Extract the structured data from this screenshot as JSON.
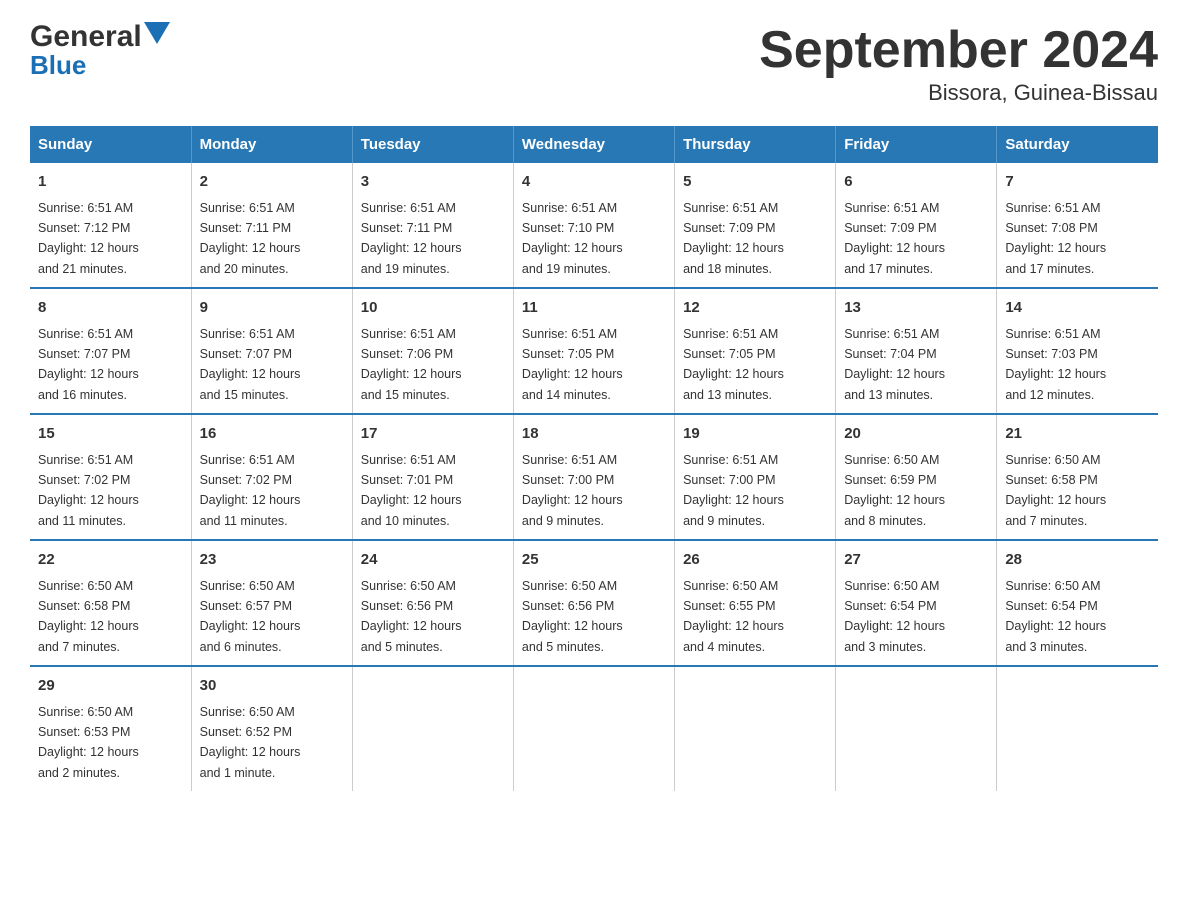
{
  "header": {
    "logo_general": "General",
    "logo_blue": "Blue",
    "title": "September 2024",
    "subtitle": "Bissora, Guinea-Bissau"
  },
  "days_of_week": [
    "Sunday",
    "Monday",
    "Tuesday",
    "Wednesday",
    "Thursday",
    "Friday",
    "Saturday"
  ],
  "weeks": [
    [
      {
        "day": "1",
        "sunrise": "6:51 AM",
        "sunset": "7:12 PM",
        "daylight": "12 hours and 21 minutes."
      },
      {
        "day": "2",
        "sunrise": "6:51 AM",
        "sunset": "7:11 PM",
        "daylight": "12 hours and 20 minutes."
      },
      {
        "day": "3",
        "sunrise": "6:51 AM",
        "sunset": "7:11 PM",
        "daylight": "12 hours and 19 minutes."
      },
      {
        "day": "4",
        "sunrise": "6:51 AM",
        "sunset": "7:10 PM",
        "daylight": "12 hours and 19 minutes."
      },
      {
        "day": "5",
        "sunrise": "6:51 AM",
        "sunset": "7:09 PM",
        "daylight": "12 hours and 18 minutes."
      },
      {
        "day": "6",
        "sunrise": "6:51 AM",
        "sunset": "7:09 PM",
        "daylight": "12 hours and 17 minutes."
      },
      {
        "day": "7",
        "sunrise": "6:51 AM",
        "sunset": "7:08 PM",
        "daylight": "12 hours and 17 minutes."
      }
    ],
    [
      {
        "day": "8",
        "sunrise": "6:51 AM",
        "sunset": "7:07 PM",
        "daylight": "12 hours and 16 minutes."
      },
      {
        "day": "9",
        "sunrise": "6:51 AM",
        "sunset": "7:07 PM",
        "daylight": "12 hours and 15 minutes."
      },
      {
        "day": "10",
        "sunrise": "6:51 AM",
        "sunset": "7:06 PM",
        "daylight": "12 hours and 15 minutes."
      },
      {
        "day": "11",
        "sunrise": "6:51 AM",
        "sunset": "7:05 PM",
        "daylight": "12 hours and 14 minutes."
      },
      {
        "day": "12",
        "sunrise": "6:51 AM",
        "sunset": "7:05 PM",
        "daylight": "12 hours and 13 minutes."
      },
      {
        "day": "13",
        "sunrise": "6:51 AM",
        "sunset": "7:04 PM",
        "daylight": "12 hours and 13 minutes."
      },
      {
        "day": "14",
        "sunrise": "6:51 AM",
        "sunset": "7:03 PM",
        "daylight": "12 hours and 12 minutes."
      }
    ],
    [
      {
        "day": "15",
        "sunrise": "6:51 AM",
        "sunset": "7:02 PM",
        "daylight": "12 hours and 11 minutes."
      },
      {
        "day": "16",
        "sunrise": "6:51 AM",
        "sunset": "7:02 PM",
        "daylight": "12 hours and 11 minutes."
      },
      {
        "day": "17",
        "sunrise": "6:51 AM",
        "sunset": "7:01 PM",
        "daylight": "12 hours and 10 minutes."
      },
      {
        "day": "18",
        "sunrise": "6:51 AM",
        "sunset": "7:00 PM",
        "daylight": "12 hours and 9 minutes."
      },
      {
        "day": "19",
        "sunrise": "6:51 AM",
        "sunset": "7:00 PM",
        "daylight": "12 hours and 9 minutes."
      },
      {
        "day": "20",
        "sunrise": "6:50 AM",
        "sunset": "6:59 PM",
        "daylight": "12 hours and 8 minutes."
      },
      {
        "day": "21",
        "sunrise": "6:50 AM",
        "sunset": "6:58 PM",
        "daylight": "12 hours and 7 minutes."
      }
    ],
    [
      {
        "day": "22",
        "sunrise": "6:50 AM",
        "sunset": "6:58 PM",
        "daylight": "12 hours and 7 minutes."
      },
      {
        "day": "23",
        "sunrise": "6:50 AM",
        "sunset": "6:57 PM",
        "daylight": "12 hours and 6 minutes."
      },
      {
        "day": "24",
        "sunrise": "6:50 AM",
        "sunset": "6:56 PM",
        "daylight": "12 hours and 5 minutes."
      },
      {
        "day": "25",
        "sunrise": "6:50 AM",
        "sunset": "6:56 PM",
        "daylight": "12 hours and 5 minutes."
      },
      {
        "day": "26",
        "sunrise": "6:50 AM",
        "sunset": "6:55 PM",
        "daylight": "12 hours and 4 minutes."
      },
      {
        "day": "27",
        "sunrise": "6:50 AM",
        "sunset": "6:54 PM",
        "daylight": "12 hours and 3 minutes."
      },
      {
        "day": "28",
        "sunrise": "6:50 AM",
        "sunset": "6:54 PM",
        "daylight": "12 hours and 3 minutes."
      }
    ],
    [
      {
        "day": "29",
        "sunrise": "6:50 AM",
        "sunset": "6:53 PM",
        "daylight": "12 hours and 2 minutes."
      },
      {
        "day": "30",
        "sunrise": "6:50 AM",
        "sunset": "6:52 PM",
        "daylight": "12 hours and 1 minute."
      },
      null,
      null,
      null,
      null,
      null
    ]
  ],
  "labels": {
    "sunrise": "Sunrise:",
    "sunset": "Sunset:",
    "daylight": "Daylight:"
  }
}
